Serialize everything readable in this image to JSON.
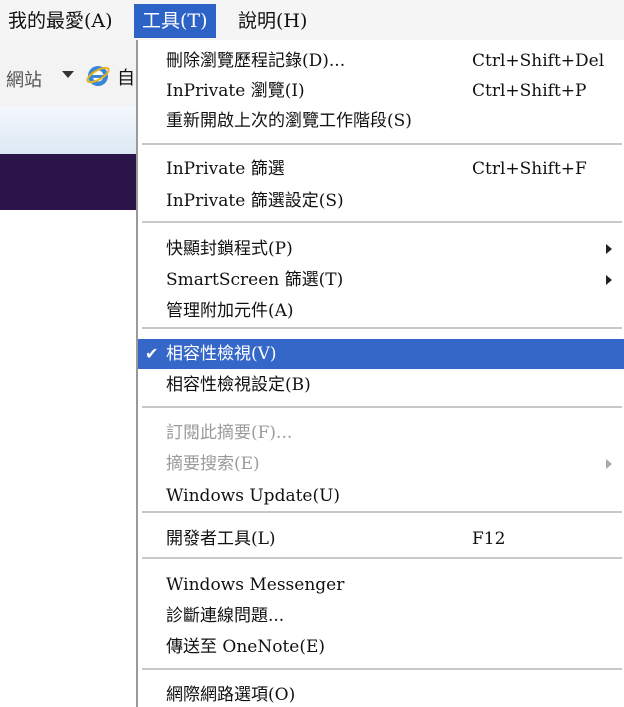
{
  "menubar": {
    "favorites": "我的最愛(A)",
    "tools": "工具(T)",
    "help": "說明(H)"
  },
  "toolbar": {
    "sites_label": "網站",
    "trailing_char": "自"
  },
  "tools_menu": {
    "groups": [
      [
        {
          "label": "刪除瀏覽歷程記錄(D)...",
          "shortcut": "Ctrl+Shift+Del"
        },
        {
          "label": "InPrivate 瀏覽(I)",
          "shortcut": "Ctrl+Shift+P"
        },
        {
          "label": "重新開啟上次的瀏覽工作階段(S)",
          "shortcut": ""
        }
      ],
      [
        {
          "label": "InPrivate 篩選",
          "shortcut": "Ctrl+Shift+F"
        },
        {
          "label": "InPrivate 篩選設定(S)",
          "shortcut": ""
        }
      ],
      [
        {
          "label": "快顯封鎖程式(P)",
          "shortcut": "",
          "submenu": true
        },
        {
          "label": "SmartScreen 篩選(T)",
          "shortcut": "",
          "submenu": true
        },
        {
          "label": "管理附加元件(A)",
          "shortcut": ""
        }
      ],
      [
        {
          "label": "相容性檢視(V)",
          "shortcut": "",
          "checked": true,
          "highlighted": true
        },
        {
          "label": "相容性檢視設定(B)",
          "shortcut": ""
        }
      ],
      [
        {
          "label": "訂閱此摘要(F)...",
          "shortcut": "",
          "disabled": true
        },
        {
          "label": "摘要搜索(E)",
          "shortcut": "",
          "disabled": true,
          "submenu": true
        },
        {
          "label": "Windows Update(U)",
          "shortcut": ""
        }
      ],
      [
        {
          "label": "開發者工具(L)",
          "shortcut": "F12"
        }
      ],
      [
        {
          "label": "Windows Messenger",
          "shortcut": ""
        },
        {
          "label": "診斷連線問題...",
          "shortcut": ""
        },
        {
          "label": "傳送至 OneNote(E)",
          "shortcut": ""
        }
      ],
      [
        {
          "label": "網際網路選項(O)",
          "shortcut": ""
        }
      ]
    ]
  },
  "colors": {
    "menu_highlight": "#3567c8",
    "menubar_active": "#2d62c6",
    "purple_band": "#2a1448"
  },
  "icons": {
    "check": "checkmark-icon",
    "submenu": "submenu-arrow-icon",
    "browser": "internet-explorer-icon"
  }
}
